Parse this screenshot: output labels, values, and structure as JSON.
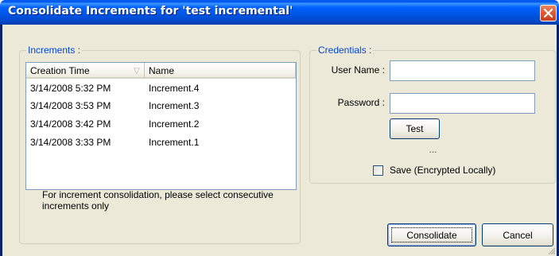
{
  "window": {
    "title": "Consolidate Increments for 'test incremental'"
  },
  "increments": {
    "group_label": "Increments :",
    "columns": [
      "Creation Time",
      "Name"
    ],
    "sort_indicator": "▽",
    "rows": [
      {
        "time": "3/14/2008 5:32 PM",
        "name": "Increment.4"
      },
      {
        "time": "3/14/2008 3:53 PM",
        "name": "Increment.3"
      },
      {
        "time": "3/14/2008 3:42 PM",
        "name": "Increment.2"
      },
      {
        "time": "3/14/2008 3:33 PM",
        "name": "Increment.1"
      }
    ],
    "note": "For increment consolidation, please select consecutive increments only"
  },
  "credentials": {
    "group_label": "Credentials :",
    "username_label": "User Name :",
    "username_value": "",
    "password_label": "Password :",
    "password_value": "",
    "test_button": "Test",
    "status": "...",
    "save_label": "Save (Encrypted Locally)",
    "save_checked": false
  },
  "buttons": {
    "consolidate": "Consolidate",
    "cancel": "Cancel"
  },
  "colors": {
    "titlebar": "#0054e3",
    "group_title": "#0046d5",
    "dialog_bg": "#ece9d8",
    "close_button": "#e25a2f"
  }
}
